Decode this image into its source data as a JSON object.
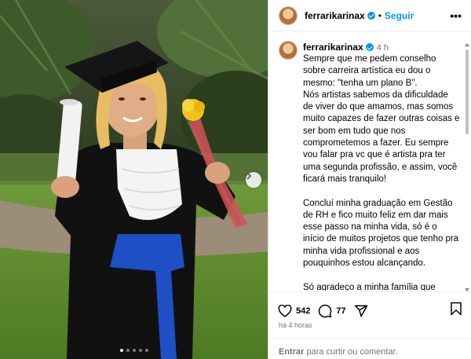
{
  "post": {
    "username": "ferrarikarinax",
    "follow_label": "Seguir",
    "separator": "•",
    "more_label": "•••"
  },
  "caption": {
    "username": "ferrarikarinax",
    "time": "4 h",
    "text": "Sempre que me pedem conselho sobre carreira artística eu dou o mesmo: \"tenha um plano B\".\nNós artistas sabemos da dificuldade de viver do que amamos, mas somos muito capazes de fazer outras coisas e ser bom em tudo que nos comprometemos a fazer. Eu sempre vou falar pra vc que é artista pra ter uma segunda profissão, e assim, você ficará mais tranquilo!\n\nConcluí minha graduação em Gestão de RH e fico muito feliz em dar mais esse passo na minha vida, só é o início de muitos projetos que tenho pra minha vida profissional e aos pouquinhos estou alcançando.\n\nSó agradeço a minha família que sempre me incentivou a tudo na minha vida, sem eles eu não sou nada",
    "emoji": "❤️"
  },
  "actions": {
    "likes": "542",
    "comments": "77",
    "time_ago": "há 4 horas"
  },
  "login": {
    "link": "Entrar",
    "text": " para curtir ou comentar."
  },
  "carousel": {
    "dots": 5,
    "active_index": 0
  },
  "colors": {
    "accent": "#0095f6",
    "secondary_text": "#737373",
    "gown": "#111111",
    "sash": "#1f4fc4"
  },
  "icons": [
    "verified-badge-icon",
    "heart-icon",
    "comment-icon",
    "share-icon",
    "bookmark-icon",
    "chevron-right-icon"
  ]
}
